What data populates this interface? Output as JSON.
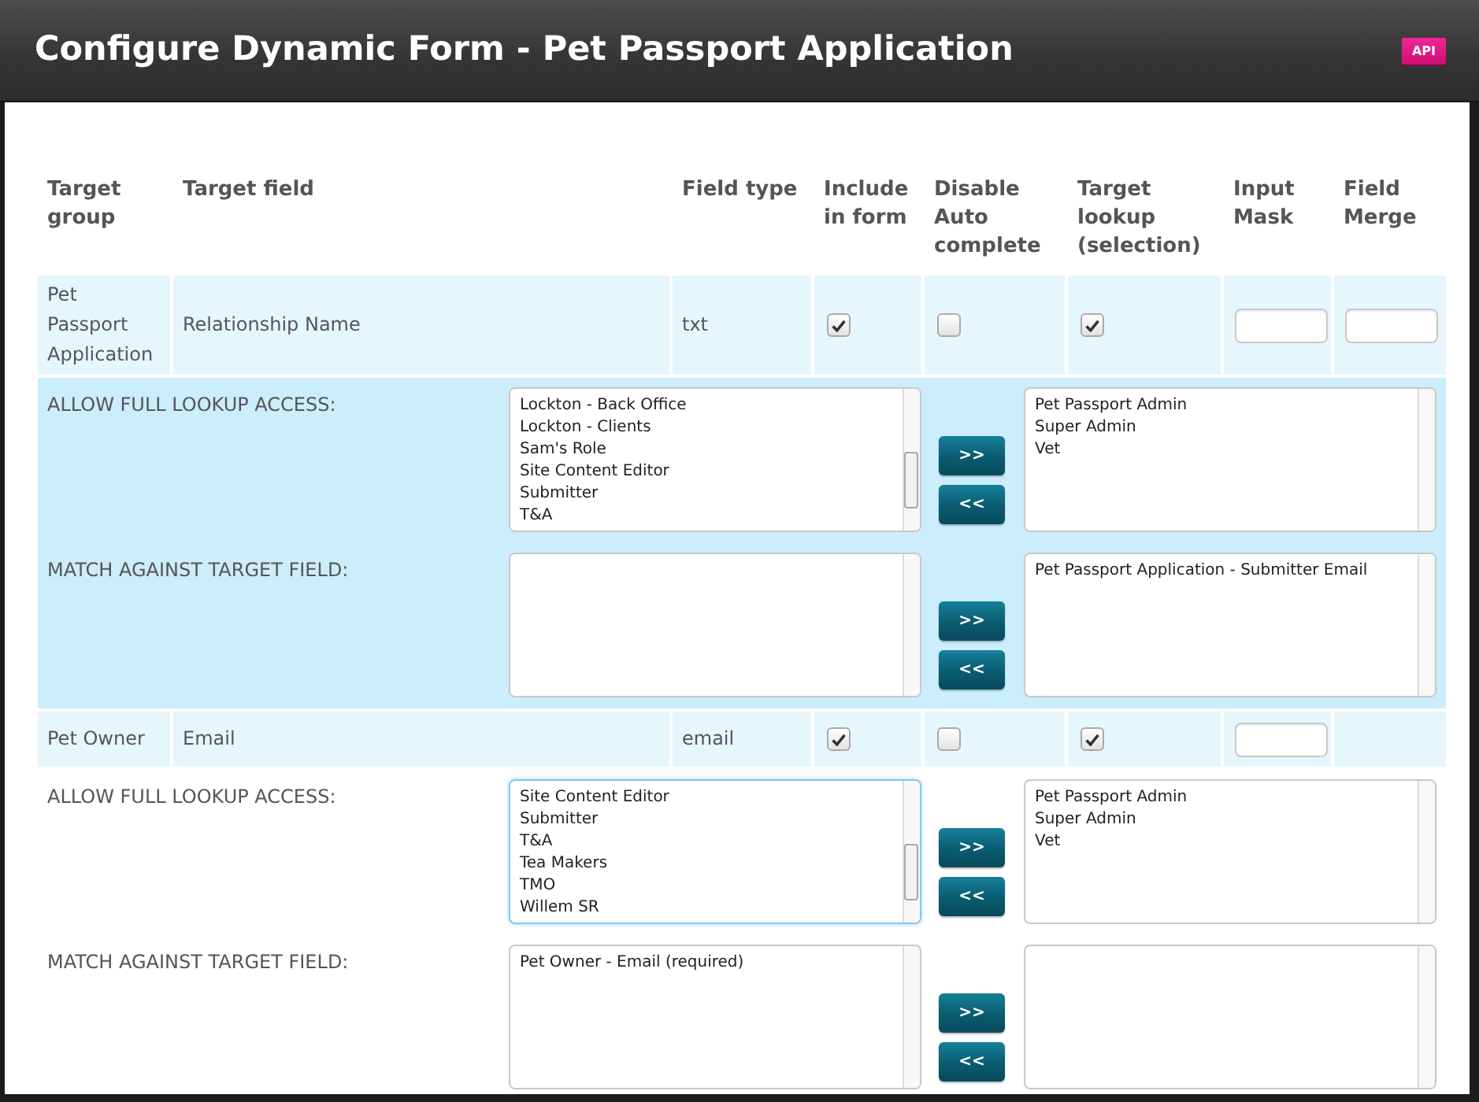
{
  "window": {
    "title": "Configure Dynamic Form - Pet Passport Application",
    "badge": "API"
  },
  "table": {
    "columns": [
      "Target group",
      "Target field",
      "Field type",
      "Include in form",
      "Disable Auto complete",
      "Target lookup (selection)",
      "Input Mask",
      "Field Merge"
    ],
    "rows": [
      {
        "target_group": "Pet Passport Application",
        "target_field": "Relationship Name",
        "field_type": "txt",
        "include_in_form": true,
        "disable_auto_complete": false,
        "target_lookup": true,
        "input_mask_field": true,
        "field_merge_field": true,
        "details": {
          "highlighted": true,
          "sections": [
            {
              "label": "ALLOW FULL LOOKUP ACCESS:",
              "available": {
                "items": [
                  "Lockton - Back Office",
                  "Lockton - Clients",
                  "Sam's Role",
                  "Site Content Editor",
                  "Submitter",
                  "T&A"
                ],
                "focused": false
              },
              "buttons": [
                ">>",
                "<<"
              ],
              "chosen": {
                "items": [
                  "Pet Passport Admin",
                  "Super Admin",
                  "Vet"
                ],
                "focused": false
              }
            },
            {
              "label": "MATCH AGAINST TARGET FIELD:",
              "available": {
                "focused": false
              },
              "buttons": [
                ">>",
                "<<"
              ],
              "chosen": {
                "items": [
                  "Pet Passport Application - Submitter Email"
                ],
                "focused": false
              }
            }
          ]
        }
      },
      {
        "target_group": "Pet Owner",
        "target_field": "Email",
        "field_type": "email",
        "include_in_form": true,
        "disable_auto_complete": false,
        "target_lookup": true,
        "input_mask_field": true,
        "field_merge_field": false,
        "details": {
          "highlighted": false,
          "sections": [
            {
              "label": "ALLOW FULL LOOKUP ACCESS:",
              "available": {
                "items": [
                  "Site Content Editor",
                  "Submitter",
                  "T&A",
                  "Tea Makers",
                  "TMO",
                  "Willem SR"
                ],
                "focused": true
              },
              "buttons": [
                ">>",
                "<<"
              ],
              "chosen": {
                "items": [
                  "Pet Passport Admin",
                  "Super Admin",
                  "Vet"
                ],
                "focused": false
              }
            },
            {
              "label": "MATCH AGAINST TARGET FIELD:",
              "available": {
                "items": [
                  "Pet Owner - Email (required)"
                ],
                "focused": false
              },
              "buttons": [
                ">>",
                "<<"
              ],
              "chosen": {
                "focused": false
              }
            }
          ]
        }
      }
    ]
  }
}
